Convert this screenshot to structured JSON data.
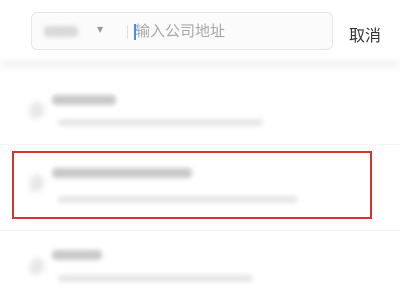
{
  "search": {
    "placeholder": "输入公司地址",
    "value": "",
    "cancel_label": "取消"
  },
  "icons": {
    "dropdown": "chevron-down-icon",
    "result": "location-pin-icon"
  },
  "colors": {
    "highlight_border": "#d63333",
    "cursor": "#3f8ef5"
  }
}
